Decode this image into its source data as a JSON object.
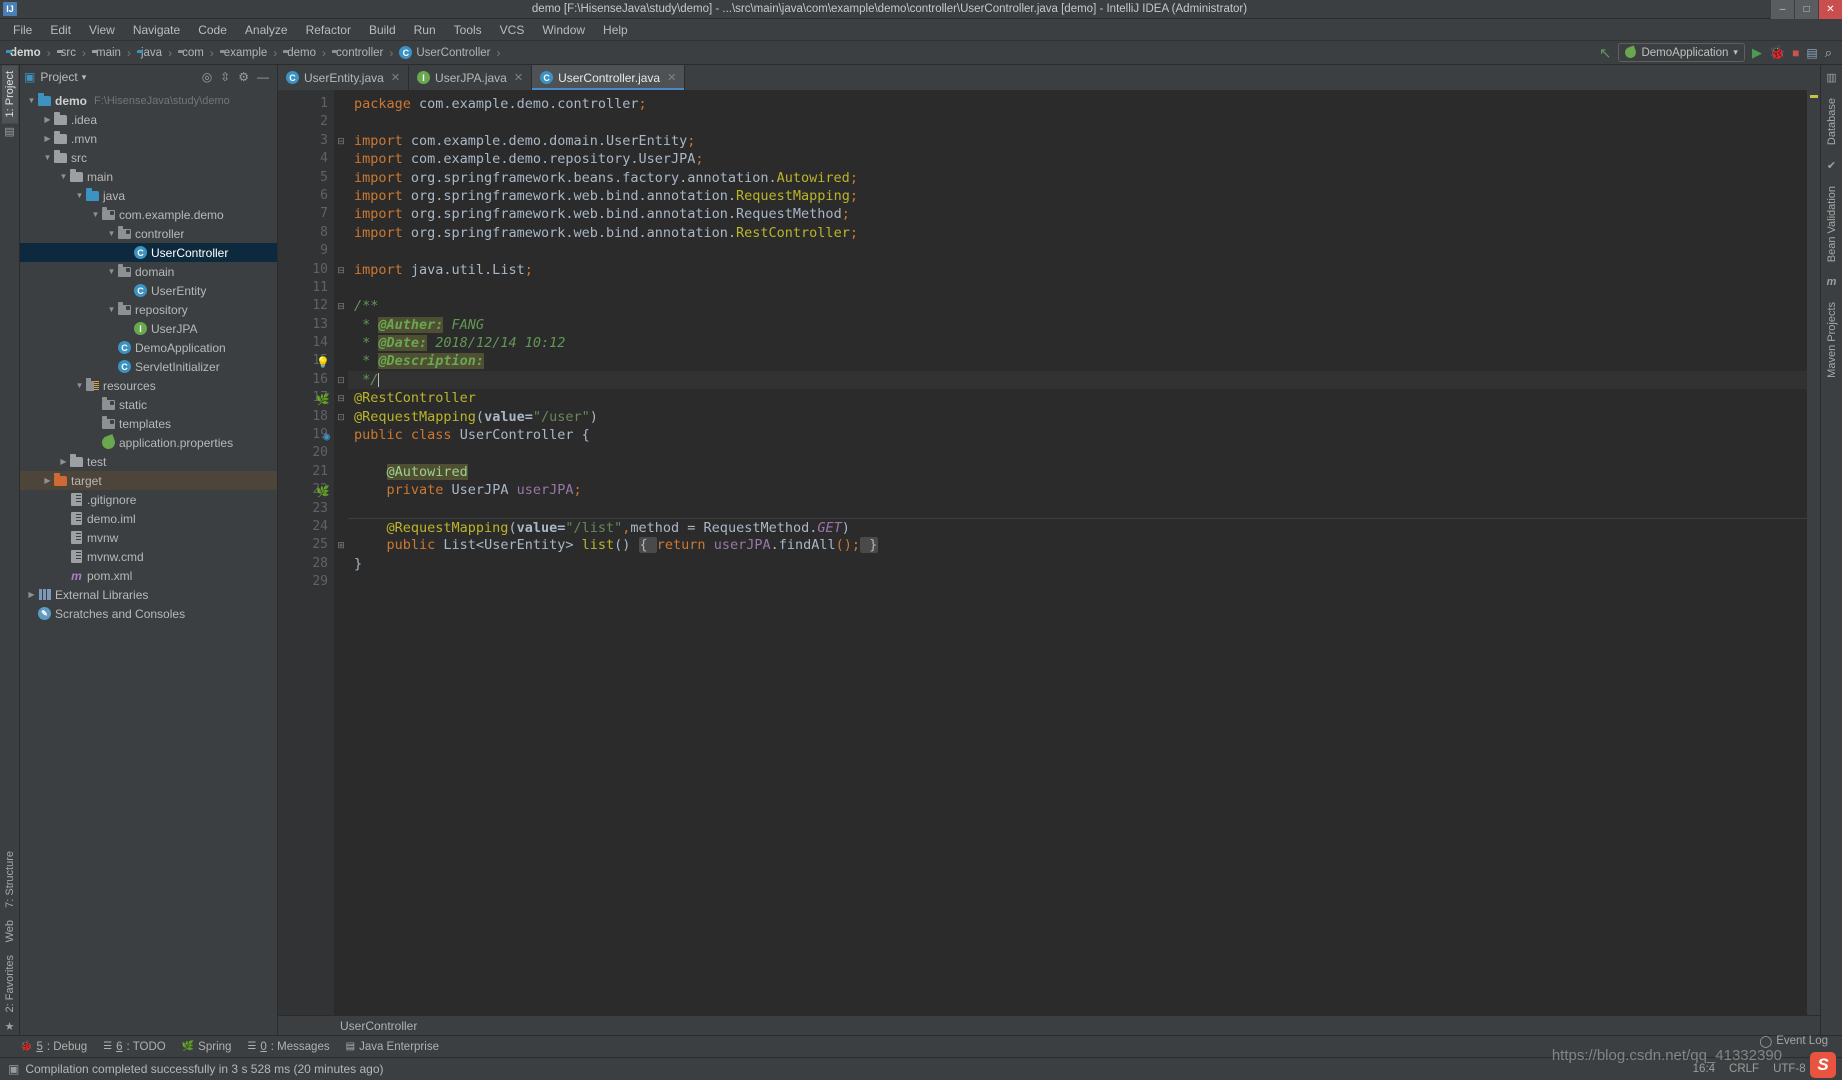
{
  "window": {
    "title": "demo [F:\\HisenseJava\\study\\demo] - ...\\src\\main\\java\\com\\example\\demo\\controller\\UserController.java [demo] - IntelliJ IDEA (Administrator)",
    "minimize": "–",
    "maximize": "□",
    "close": "✕",
    "app_icon_letter": "IJ"
  },
  "menubar": {
    "items": [
      "File",
      "Edit",
      "View",
      "Navigate",
      "Code",
      "Analyze",
      "Refactor",
      "Build",
      "Run",
      "Tools",
      "VCS",
      "Window",
      "Help"
    ]
  },
  "breadcrumb": {
    "items": [
      {
        "label": "demo",
        "icon": "module-icon",
        "bold": true
      },
      {
        "label": "src",
        "icon": "folder-icon",
        "bold": false
      },
      {
        "label": "main",
        "icon": "folder-icon",
        "bold": false
      },
      {
        "label": "java",
        "icon": "source-folder-icon",
        "bold": false
      },
      {
        "label": "com",
        "icon": "package-icon",
        "bold": false
      },
      {
        "label": "example",
        "icon": "package-icon",
        "bold": false
      },
      {
        "label": "demo",
        "icon": "package-icon",
        "bold": false
      },
      {
        "label": "controller",
        "icon": "package-icon",
        "bold": false
      },
      {
        "label": "UserController",
        "icon": "class-icon",
        "bold": false
      }
    ],
    "separator": "›"
  },
  "toolbar": {
    "run_config": "DemoApplication",
    "dropdown_arrow": "▾",
    "run_label": "▶",
    "debug_label": "Debug",
    "stop_label": "■",
    "back_arrow": "↖"
  },
  "project_panel": {
    "title": "Project",
    "dropdown": "▾",
    "actions": [
      "locate-icon",
      "collapse-all-icon",
      "settings-icon",
      "hide-icon"
    ],
    "tree": [
      {
        "depth": 0,
        "arrow": "▼",
        "icon": "module-icon",
        "label": "demo",
        "path": "F:\\HisenseJava\\study\\demo",
        "bold": true,
        "state": "normal"
      },
      {
        "depth": 1,
        "arrow": "▶",
        "icon": "folder-icon",
        "label": ".idea",
        "path": "",
        "bold": false,
        "state": "normal"
      },
      {
        "depth": 1,
        "arrow": "▶",
        "icon": "folder-icon",
        "label": ".mvn",
        "path": "",
        "bold": false,
        "state": "normal"
      },
      {
        "depth": 1,
        "arrow": "▼",
        "icon": "folder-icon",
        "label": "src",
        "path": "",
        "bold": false,
        "state": "normal"
      },
      {
        "depth": 2,
        "arrow": "▼",
        "icon": "folder-icon",
        "label": "main",
        "path": "",
        "bold": false,
        "state": "normal"
      },
      {
        "depth": 3,
        "arrow": "▼",
        "icon": "source-folder-icon",
        "label": "java",
        "path": "",
        "bold": false,
        "state": "normal"
      },
      {
        "depth": 4,
        "arrow": "▼",
        "icon": "package-icon",
        "label": "com.example.demo",
        "path": "",
        "bold": false,
        "state": "normal"
      },
      {
        "depth": 5,
        "arrow": "▼",
        "icon": "package-icon",
        "label": "controller",
        "path": "",
        "bold": false,
        "state": "normal"
      },
      {
        "depth": 6,
        "arrow": "",
        "icon": "class-icon",
        "label": "UserController",
        "path": "",
        "bold": false,
        "state": "selected"
      },
      {
        "depth": 5,
        "arrow": "▼",
        "icon": "package-icon",
        "label": "domain",
        "path": "",
        "bold": false,
        "state": "normal"
      },
      {
        "depth": 6,
        "arrow": "",
        "icon": "class-icon",
        "label": "UserEntity",
        "path": "",
        "bold": false,
        "state": "normal"
      },
      {
        "depth": 5,
        "arrow": "▼",
        "icon": "package-icon",
        "label": "repository",
        "path": "",
        "bold": false,
        "state": "normal"
      },
      {
        "depth": 6,
        "arrow": "",
        "icon": "interface-icon",
        "label": "UserJPA",
        "path": "",
        "bold": false,
        "state": "normal"
      },
      {
        "depth": 5,
        "arrow": "",
        "icon": "spring-class-icon",
        "label": "DemoApplication",
        "path": "",
        "bold": false,
        "state": "normal"
      },
      {
        "depth": 5,
        "arrow": "",
        "icon": "class-icon",
        "label": "ServletInitializer",
        "path": "",
        "bold": false,
        "state": "normal"
      },
      {
        "depth": 3,
        "arrow": "▼",
        "icon": "resource-folder-icon",
        "label": "resources",
        "path": "",
        "bold": false,
        "state": "normal"
      },
      {
        "depth": 4,
        "arrow": "",
        "icon": "package-icon",
        "label": "static",
        "path": "",
        "bold": false,
        "state": "normal"
      },
      {
        "depth": 4,
        "arrow": "",
        "icon": "package-icon",
        "label": "templates",
        "path": "",
        "bold": false,
        "state": "normal"
      },
      {
        "depth": 4,
        "arrow": "",
        "icon": "spring-leaf-icon",
        "label": "application.properties",
        "path": "",
        "bold": false,
        "state": "normal"
      },
      {
        "depth": 2,
        "arrow": "▶",
        "icon": "folder-icon",
        "label": "test",
        "path": "",
        "bold": false,
        "state": "normal"
      },
      {
        "depth": 1,
        "arrow": "▶",
        "icon": "excluded-folder-icon",
        "label": "target",
        "path": "",
        "bold": false,
        "state": "highlight"
      },
      {
        "depth": 2,
        "arrow": "",
        "icon": "file-icon",
        "label": ".gitignore",
        "path": "",
        "bold": false,
        "state": "normal"
      },
      {
        "depth": 2,
        "arrow": "",
        "icon": "iml-file-icon",
        "label": "demo.iml",
        "path": "",
        "bold": false,
        "state": "normal"
      },
      {
        "depth": 2,
        "arrow": "",
        "icon": "file-icon",
        "label": "mvnw",
        "path": "",
        "bold": false,
        "state": "normal"
      },
      {
        "depth": 2,
        "arrow": "",
        "icon": "file-icon",
        "label": "mvnw.cmd",
        "path": "",
        "bold": false,
        "state": "normal"
      },
      {
        "depth": 2,
        "arrow": "",
        "icon": "maven-file-icon",
        "label": "pom.xml",
        "path": "",
        "bold": false,
        "state": "normal"
      },
      {
        "depth": 0,
        "arrow": "▶",
        "icon": "libraries-icon",
        "label": "External Libraries",
        "path": "",
        "bold": false,
        "state": "normal"
      },
      {
        "depth": 0,
        "arrow": "",
        "icon": "scratches-icon",
        "label": "Scratches and Consoles",
        "path": "",
        "bold": false,
        "state": "normal"
      }
    ]
  },
  "left_strip": {
    "top": [
      "1: Project"
    ],
    "bottom": [
      "7: Structure",
      "2: Favorites"
    ],
    "web_label": "Web"
  },
  "right_strip": {
    "items": [
      "Database",
      "Bean Validation",
      "Maven Projects"
    ]
  },
  "editor": {
    "tabs": [
      {
        "label": "UserEntity.java",
        "icon": "class-icon",
        "active": false,
        "close": "✕"
      },
      {
        "label": "UserJPA.java",
        "icon": "interface-icon",
        "active": false,
        "close": "✕"
      },
      {
        "label": "UserController.java",
        "icon": "class-icon",
        "active": true,
        "close": "✕"
      }
    ],
    "breadcrumb": "UserController",
    "line_numbers": [
      "1",
      "2",
      "3",
      "4",
      "5",
      "6",
      "7",
      "8",
      "9",
      "10",
      "11",
      "12",
      "13",
      "14",
      "15",
      "16",
      "17",
      "18",
      "19",
      "20",
      "21",
      "22",
      "23",
      "24",
      "25",
      "28",
      "29"
    ]
  },
  "code_lines": [
    {
      "n": "1",
      "tokens": [
        {
          "t": "package",
          "c": "kw"
        },
        {
          "t": " com.example.demo.controller",
          "c": "plain"
        },
        {
          "t": ";",
          "c": "semi"
        }
      ]
    },
    {
      "n": "2",
      "tokens": []
    },
    {
      "n": "3",
      "tokens": [
        {
          "t": "import",
          "c": "kw"
        },
        {
          "t": " com.example.demo.domain.UserEntity",
          "c": "plain"
        },
        {
          "t": ";",
          "c": "semi"
        }
      ]
    },
    {
      "n": "4",
      "tokens": [
        {
          "t": "import",
          "c": "kw"
        },
        {
          "t": " com.example.demo.repository.UserJPA",
          "c": "plain"
        },
        {
          "t": ";",
          "c": "semi"
        }
      ]
    },
    {
      "n": "5",
      "tokens": [
        {
          "t": "import",
          "c": "kw"
        },
        {
          "t": " org.springframework.beans.factory.annotation.",
          "c": "plain"
        },
        {
          "t": "Autowired",
          "c": "ann"
        },
        {
          "t": ";",
          "c": "semi"
        }
      ]
    },
    {
      "n": "6",
      "tokens": [
        {
          "t": "import",
          "c": "kw"
        },
        {
          "t": " org.springframework.web.bind.annotation.",
          "c": "plain"
        },
        {
          "t": "RequestMapping",
          "c": "ann"
        },
        {
          "t": ";",
          "c": "semi"
        }
      ]
    },
    {
      "n": "7",
      "tokens": [
        {
          "t": "import",
          "c": "kw"
        },
        {
          "t": " org.springframework.web.bind.annotation.",
          "c": "plain"
        },
        {
          "t": "RequestMethod",
          "c": "plain"
        },
        {
          "t": ";",
          "c": "semi"
        }
      ]
    },
    {
      "n": "8",
      "tokens": [
        {
          "t": "import",
          "c": "kw"
        },
        {
          "t": " org.springframework.web.bind.annotation.",
          "c": "plain"
        },
        {
          "t": "RestController",
          "c": "ann"
        },
        {
          "t": ";",
          "c": "semi"
        }
      ]
    },
    {
      "n": "9",
      "tokens": []
    },
    {
      "n": "10",
      "tokens": [
        {
          "t": "import",
          "c": "kw"
        },
        {
          "t": " java.util.List",
          "c": "plain"
        },
        {
          "t": ";",
          "c": "semi"
        }
      ]
    },
    {
      "n": "11",
      "tokens": []
    },
    {
      "n": "12",
      "tokens": [
        {
          "t": "/**",
          "c": "cmt"
        }
      ]
    },
    {
      "n": "13",
      "tokens": [
        {
          "t": " * ",
          "c": "cmt"
        },
        {
          "t": "@Auther:",
          "c": "cmt-tag"
        },
        {
          "t": " FANG",
          "c": "cmt"
        }
      ]
    },
    {
      "n": "14",
      "tokens": [
        {
          "t": " * ",
          "c": "cmt"
        },
        {
          "t": "@Date:",
          "c": "cmt-tag"
        },
        {
          "t": " 2018/12/14 10:12",
          "c": "cmt"
        }
      ]
    },
    {
      "n": "15",
      "tokens": [
        {
          "t": " * ",
          "c": "cmt"
        },
        {
          "t": "@Description:",
          "c": "cmt-tag"
        }
      ]
    },
    {
      "n": "16",
      "tokens": [
        {
          "t": " */",
          "c": "cmt"
        }
      ]
    },
    {
      "n": "17",
      "tokens": [
        {
          "t": "@RestController",
          "c": "ann-green"
        }
      ]
    },
    {
      "n": "18",
      "tokens": [
        {
          "t": "@RequestMapping",
          "c": "ann-green"
        },
        {
          "t": "(",
          "c": "plain"
        },
        {
          "t": "value=",
          "c": "bold-plain"
        },
        {
          "t": "\"/user\"",
          "c": "str"
        },
        {
          "t": ")",
          "c": "plain"
        }
      ]
    },
    {
      "n": "19",
      "tokens": [
        {
          "t": "public",
          "c": "kw"
        },
        {
          "t": " ",
          "c": "plain"
        },
        {
          "t": "class",
          "c": "kw"
        },
        {
          "t": " UserController {",
          "c": "plain"
        }
      ]
    },
    {
      "n": "20",
      "tokens": []
    },
    {
      "n": "21",
      "tokens": [
        {
          "t": "    ",
          "c": "plain"
        },
        {
          "t": "@Autowired",
          "c": "hl-ann"
        }
      ]
    },
    {
      "n": "22",
      "tokens": [
        {
          "t": "    ",
          "c": "plain"
        },
        {
          "t": "private",
          "c": "kw"
        },
        {
          "t": " UserJPA ",
          "c": "plain"
        },
        {
          "t": "userJPA",
          "c": "fld"
        },
        {
          "t": ";",
          "c": "semi"
        }
      ]
    },
    {
      "n": "23",
      "tokens": []
    },
    {
      "n": "24",
      "tokens": [
        {
          "t": "    ",
          "c": "plain"
        },
        {
          "t": "@RequestMapping",
          "c": "ann-green"
        },
        {
          "t": "(",
          "c": "plain"
        },
        {
          "t": "value=",
          "c": "bold-plain"
        },
        {
          "t": "\"/list\"",
          "c": "str"
        },
        {
          "t": ",",
          "c": "semi"
        },
        {
          "t": "method = RequestMethod.",
          "c": "plain"
        },
        {
          "t": "GET",
          "c": "fld-italic"
        },
        {
          "t": ")",
          "c": "plain"
        }
      ]
    },
    {
      "n": "25",
      "tokens": [
        {
          "t": "    ",
          "c": "plain"
        },
        {
          "t": "public",
          "c": "kw"
        },
        {
          "t": " List<UserEntity> ",
          "c": "plain"
        },
        {
          "t": "list",
          "c": "mth"
        },
        {
          "t": "() ",
          "c": "plain"
        },
        {
          "t": "{ ",
          "c": "fold"
        },
        {
          "t": "return",
          "c": "kw"
        },
        {
          "t": " ",
          "c": "plain"
        },
        {
          "t": "userJPA",
          "c": "fld"
        },
        {
          "t": ".findAll",
          "c": "plain"
        },
        {
          "t": "();",
          "c": "semi"
        },
        {
          "t": " }",
          "c": "fold"
        }
      ]
    },
    {
      "n": "28",
      "tokens": [
        {
          "t": "}",
          "c": "plain"
        }
      ]
    },
    {
      "n": "29",
      "tokens": []
    }
  ],
  "bottom_tools": [
    {
      "num": "5",
      "label": ": Debug",
      "icon": "debug-icon"
    },
    {
      "num": "6",
      "label": ": TODO",
      "icon": "todo-icon"
    },
    {
      "num": "",
      "label": "Spring",
      "icon": "spring-icon"
    },
    {
      "num": "0",
      "label": ": Messages",
      "icon": "messages-icon"
    },
    {
      "num": "",
      "label": "Java Enterprise",
      "icon": "java-enterprise-icon"
    }
  ],
  "statusbar": {
    "message": "Compilation completed successfully in 3 s 528 ms (20 minutes ago)",
    "position": "16:4",
    "line_separator": "CRLF",
    "encoding": "UTF-8",
    "lock_icon": "lock-icon",
    "event_log": "Event Log",
    "watermark": "https://blog.csdn.net/qq_41332390",
    "csdn_logo": "S"
  },
  "colors": {
    "accent": "#4a88c7",
    "selection": "#0d293e",
    "panel_bg": "#3c3f41",
    "editor_bg": "#2b2b2b",
    "gutter_bg": "#313335",
    "keyword": "#cc7832",
    "string": "#6a8759",
    "comment": "#629755",
    "annotation": "#bbb529",
    "field": "#9876aa"
  }
}
